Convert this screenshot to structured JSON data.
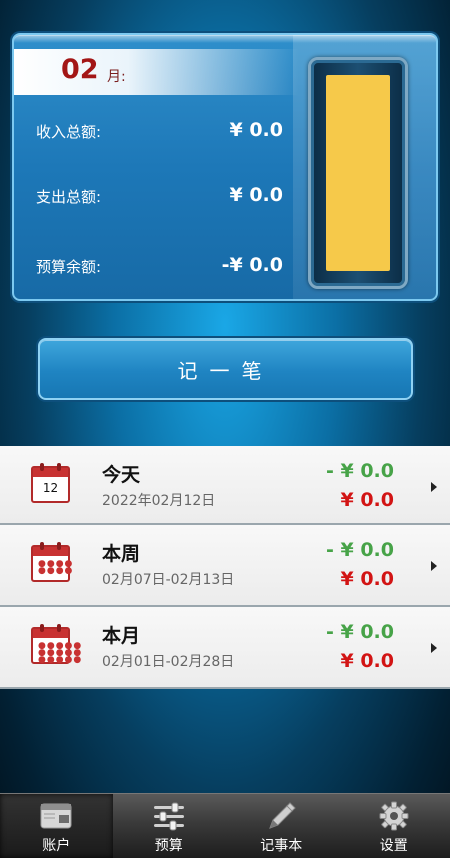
{
  "summary": {
    "month_number": "02",
    "month_unit": "月:",
    "income_label": "收入总额:",
    "income_value": "¥ 0.0",
    "expense_label": "支出总额:",
    "expense_value": "¥ 0.0",
    "budget_label": "预算余额:",
    "budget_value": "-¥ 0.0",
    "gauge_fill_fraction": 1.0,
    "gauge_color": "#f6c94a"
  },
  "record_button": {
    "label": "记一笔"
  },
  "periods": [
    {
      "title": "今天",
      "dates": "2022年02月12日",
      "income": "- ¥ 0.0",
      "expense": "¥ 0.0",
      "calendar_day": "12",
      "icon": "calendar-day-icon"
    },
    {
      "title": "本周",
      "dates": "02月07日-02月13日",
      "income": "- ¥ 0.0",
      "expense": "¥ 0.0",
      "icon": "calendar-week-icon"
    },
    {
      "title": "本月",
      "dates": "02月01日-02月28日",
      "income": "- ¥ 0.0",
      "expense": "¥ 0.0",
      "icon": "calendar-month-icon"
    }
  ],
  "tabs": [
    {
      "label": "账户",
      "icon": "wallet-icon",
      "active": true
    },
    {
      "label": "预算",
      "icon": "sliders-icon",
      "active": false
    },
    {
      "label": "记事本",
      "icon": "pencil-icon",
      "active": false
    },
    {
      "label": "设置",
      "icon": "gear-icon",
      "active": false
    }
  ],
  "colors": {
    "income": "#47a348",
    "expense": "#d21414",
    "month": "#a31616"
  }
}
